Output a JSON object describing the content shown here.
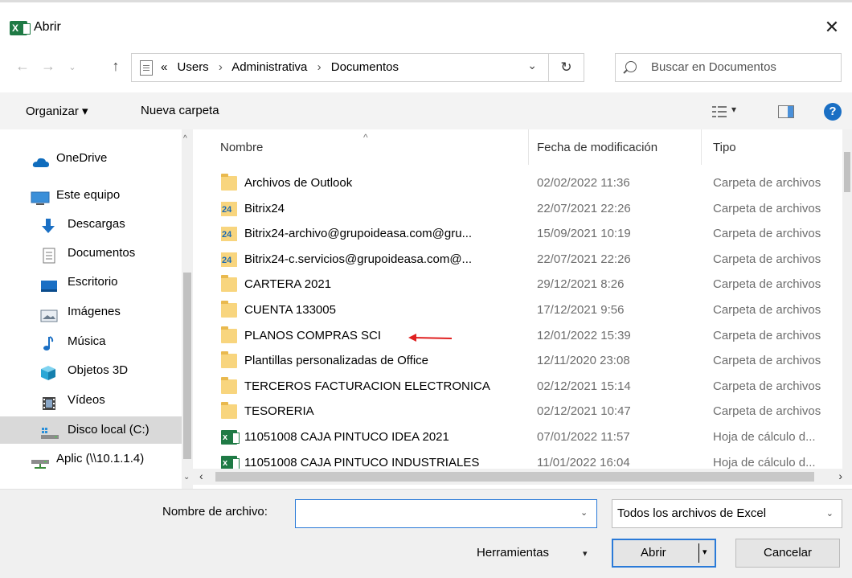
{
  "window": {
    "title": "Abrir",
    "app_icon_letter": "X",
    "close_glyph": "✕"
  },
  "nav": {
    "back": "←",
    "forward": "→",
    "recent": "⌄",
    "up": "↑"
  },
  "address": {
    "overflow": "«",
    "crumbs": [
      "Users",
      "Administrativa",
      "Documentos"
    ],
    "separator": "›",
    "dropdown": "⌄",
    "refresh": "↻"
  },
  "search": {
    "placeholder": "Buscar en Documentos"
  },
  "toolbar": {
    "organize_label": "Organizar ▾",
    "new_folder_label": "Nueva carpeta",
    "view_caret": "▾",
    "help": "?"
  },
  "navpane": {
    "items": [
      {
        "label": "OneDrive",
        "icon": "cloud-icon",
        "color": "#0f6cbd"
      },
      {
        "label": "Este equipo",
        "icon": "computer-icon",
        "color": "#3a8fd9"
      },
      {
        "label": "Descargas",
        "icon": "download-icon",
        "color": "#1a6fc4"
      },
      {
        "label": "Documentos",
        "icon": "document-icon",
        "color": "#777777"
      },
      {
        "label": "Escritorio",
        "icon": "desktop-icon",
        "color": "#1a6fc4"
      },
      {
        "label": "Imágenes",
        "icon": "image-icon",
        "color": "#6b7c8d"
      },
      {
        "label": "Música",
        "icon": "music-icon",
        "color": "#1a6fc4"
      },
      {
        "label": "Objetos 3D",
        "icon": "cube-icon",
        "color": "#2aa7d6"
      },
      {
        "label": "Vídeos",
        "icon": "video-icon",
        "color": "#444444"
      },
      {
        "label": "Disco local (C:)",
        "icon": "drive-icon",
        "color": "#6b6b6b"
      },
      {
        "label": "Aplic (\\\\10.1.1.4)",
        "icon": "network-drive-icon",
        "color": "#3b8a3b"
      }
    ]
  },
  "filelist": {
    "columns": {
      "name": "Nombre",
      "date": "Fecha de modificación",
      "type": "Tipo",
      "sort_glyph": "^"
    },
    "rows": [
      {
        "name": "Archivos de Outlook",
        "date": "02/02/2022 11:36",
        "type": "Carpeta de archivos",
        "icon": "folder"
      },
      {
        "name": "Bitrix24",
        "date": "22/07/2021 22:26",
        "type": "Carpeta de archivos",
        "icon": "bitrix"
      },
      {
        "name": "Bitrix24-archivo@grupoideasa.com@gru...",
        "date": "15/09/2021 10:19",
        "type": "Carpeta de archivos",
        "icon": "bitrix"
      },
      {
        "name": "Bitrix24-c.servicios@grupoideasa.com@...",
        "date": "22/07/2021 22:26",
        "type": "Carpeta de archivos",
        "icon": "bitrix"
      },
      {
        "name": "CARTERA 2021",
        "date": "29/12/2021 8:26",
        "type": "Carpeta de archivos",
        "icon": "folder"
      },
      {
        "name": "CUENTA 133005",
        "date": "17/12/2021 9:56",
        "type": "Carpeta de archivos",
        "icon": "folder"
      },
      {
        "name": "PLANOS COMPRAS SCI",
        "date": "12/01/2022 15:39",
        "type": "Carpeta de archivos",
        "icon": "folder"
      },
      {
        "name": "Plantillas personalizadas de Office",
        "date": "12/11/2020 23:08",
        "type": "Carpeta de archivos",
        "icon": "folder"
      },
      {
        "name": "TERCEROS FACTURACION ELECTRONICA",
        "date": "02/12/2021 15:14",
        "type": "Carpeta de archivos",
        "icon": "folder"
      },
      {
        "name": "TESORERIA",
        "date": "02/12/2021 10:47",
        "type": "Carpeta de archivos",
        "icon": "folder"
      },
      {
        "name": "11051008 CAJA PINTUCO IDEA 2021",
        "date": "07/01/2022 11:57",
        "type": "Hoja de cálculo d...",
        "icon": "excel"
      },
      {
        "name": "11051008 CAJA PINTUCO INDUSTRIALES",
        "date": "11/01/2022 16:04",
        "type": "Hoja de cálculo d...",
        "icon": "excel"
      }
    ],
    "bitrix_icon_text": "24",
    "excel_icon_text": "x"
  },
  "scroll": {
    "left": "‹",
    "right": "›",
    "up": "^",
    "down": "⌄"
  },
  "bottom": {
    "filename_label": "Nombre de archivo:",
    "filename_value": "",
    "filename_caret": "⌄",
    "filetype_value": "Todos los archivos de Excel",
    "filetype_caret": "⌄",
    "tools_label": "Herramientas",
    "tools_caret": "▾",
    "open_label": "Abrir",
    "open_caret": "▾",
    "cancel_label": "Cancelar"
  },
  "colors": {
    "accent": "#2a7ad8",
    "selected_nav": "#d9d9d9",
    "annotation_arrow": "#e02020"
  }
}
